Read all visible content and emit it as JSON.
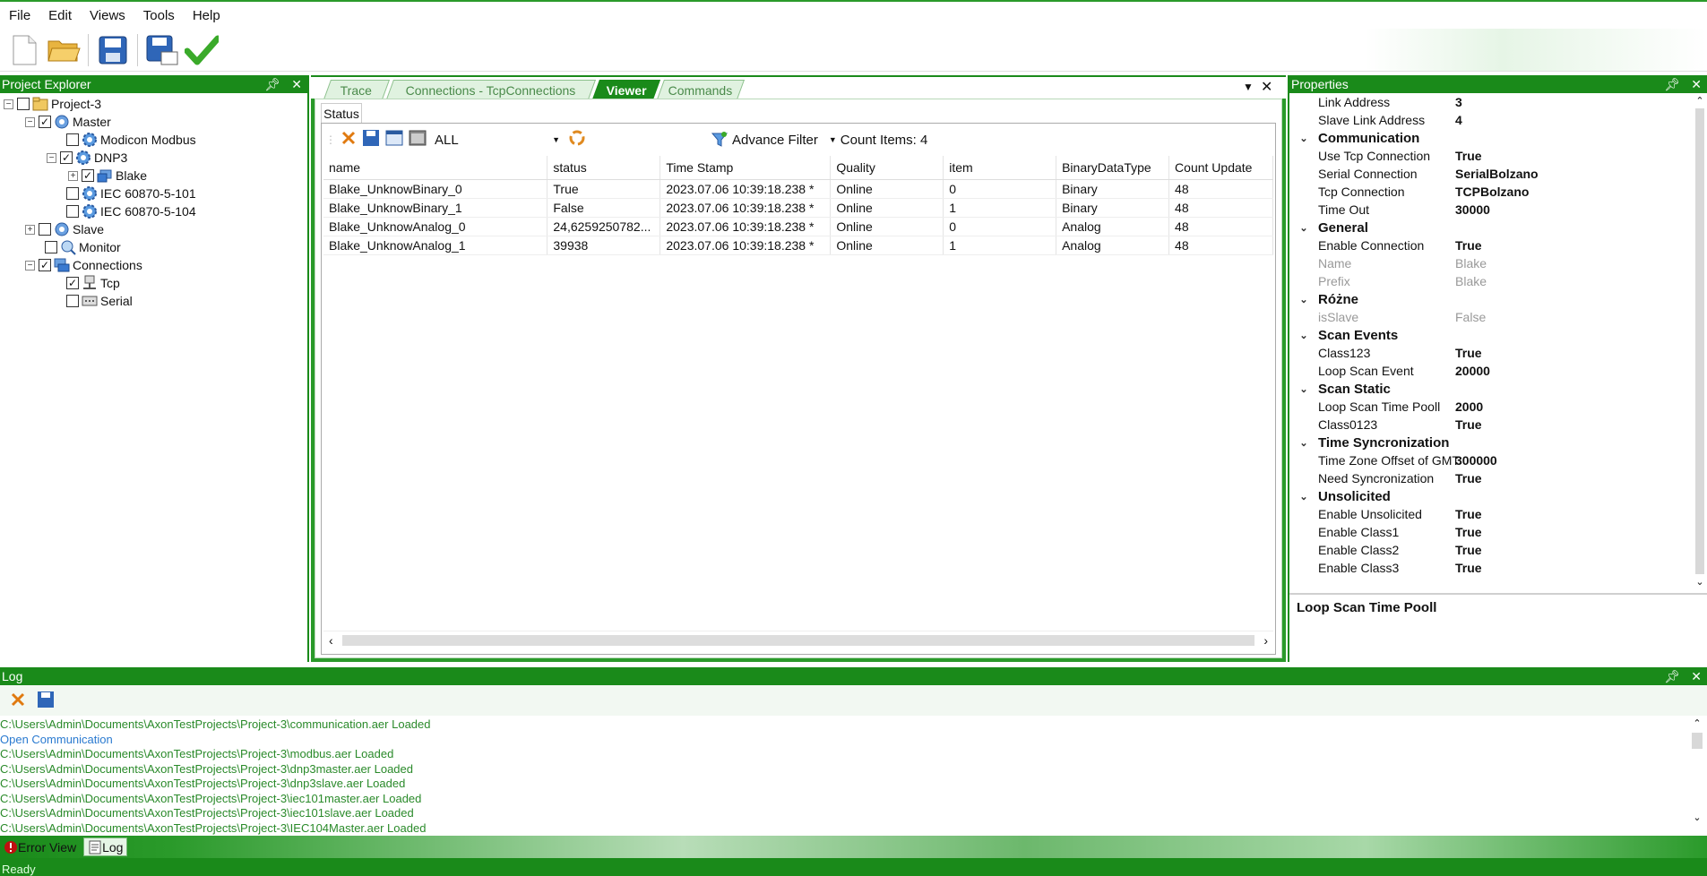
{
  "menu": [
    "File",
    "Edit",
    "Views",
    "Tools",
    "Help"
  ],
  "explorer": {
    "title": "Project Explorer",
    "items": [
      {
        "label": "Project-3"
      },
      {
        "label": "Master"
      },
      {
        "label": "Modicon Modbus"
      },
      {
        "label": "DNP3"
      },
      {
        "label": "Blake"
      },
      {
        "label": "IEC 60870-5-101"
      },
      {
        "label": "IEC 60870-5-104"
      },
      {
        "label": "Slave"
      },
      {
        "label": "Monitor"
      },
      {
        "label": "Connections"
      },
      {
        "label": "Tcp"
      },
      {
        "label": "Serial"
      }
    ]
  },
  "tabs": [
    "Trace",
    "Connections - TcpConnections",
    "Viewer",
    "Commands"
  ],
  "viewer": {
    "status_tab": "Status",
    "filter_select": "ALL",
    "advance_filter": "Advance Filter",
    "count_items": "Count Items: 4",
    "columns": [
      "name",
      "status",
      "Time Stamp",
      "Quality",
      "item",
      "BinaryDataType",
      "Count Update"
    ],
    "rows": [
      [
        "Blake_UnknowBinary_0",
        "True",
        "2023.07.06 10:39:18.238 *",
        "Online",
        "0",
        "Binary",
        "48"
      ],
      [
        "Blake_UnknowBinary_1",
        "False",
        "2023.07.06 10:39:18.238 *",
        "Online",
        "1",
        "Binary",
        "48"
      ],
      [
        "Blake_UnknowAnalog_0",
        "24,6259250782...",
        "2023.07.06 10:39:18.238 *",
        "Online",
        "0",
        "Analog",
        "48"
      ],
      [
        "Blake_UnknowAnalog_1",
        "39938",
        "2023.07.06 10:39:18.238 *",
        "Online",
        "1",
        "Analog",
        "48"
      ]
    ]
  },
  "properties": {
    "title": "Properties",
    "top_rows": [
      {
        "name": "Link Address",
        "value": "3"
      },
      {
        "name": "Slave Link Address",
        "value": "4"
      }
    ],
    "categories": [
      {
        "label": "Communication",
        "rows": [
          {
            "name": "Use Tcp Connection",
            "value": "True"
          },
          {
            "name": "Serial Connection",
            "value": "SerialBolzano"
          },
          {
            "name": "Tcp Connection",
            "value": "TCPBolzano"
          },
          {
            "name": "Time Out",
            "value": "30000"
          }
        ]
      },
      {
        "label": "General",
        "rows": [
          {
            "name": "Enable Connection",
            "value": "True"
          },
          {
            "name": "Name",
            "value": "Blake",
            "dim": true
          },
          {
            "name": "Prefix",
            "value": "Blake",
            "dim": true
          }
        ]
      },
      {
        "label": "Różne",
        "rows": [
          {
            "name": "isSlave",
            "value": "False",
            "dim": true
          }
        ]
      },
      {
        "label": "Scan Events",
        "rows": [
          {
            "name": "Class123",
            "value": "True"
          },
          {
            "name": "Loop Scan Event",
            "value": "20000"
          }
        ]
      },
      {
        "label": "Scan Static",
        "rows": [
          {
            "name": "Loop Scan Time Pooll",
            "value": "2000"
          },
          {
            "name": "Class0123",
            "value": "True"
          }
        ]
      },
      {
        "label": "Time Syncronization",
        "rows": [
          {
            "name": "Time Zone Offset of GMT",
            "value": "300000"
          },
          {
            "name": "Need Syncronization",
            "value": "True"
          }
        ]
      },
      {
        "label": "Unsolicited",
        "rows": [
          {
            "name": "Enable Unsolicited",
            "value": "True"
          },
          {
            "name": "Enable Class1",
            "value": "True"
          },
          {
            "name": "Enable Class2",
            "value": "True"
          },
          {
            "name": "Enable Class3",
            "value": "True"
          }
        ]
      }
    ],
    "description": "Loop Scan Time Pooll"
  },
  "log": {
    "title": "Log",
    "lines": [
      {
        "text": "C:\\Users\\Admin\\Documents\\AxonTestProjects\\Project-3\\communication.aer Loaded",
        "color": "#2a8a2a"
      },
      {
        "text": "Open Communication",
        "color": "#2a7ad0"
      },
      {
        "text": "C:\\Users\\Admin\\Documents\\AxonTestProjects\\Project-3\\modbus.aer Loaded",
        "color": "#2a8a2a"
      },
      {
        "text": "C:\\Users\\Admin\\Documents\\AxonTestProjects\\Project-3\\dnp3master.aer Loaded",
        "color": "#2a8a2a"
      },
      {
        "text": "C:\\Users\\Admin\\Documents\\AxonTestProjects\\Project-3\\dnp3slave.aer Loaded",
        "color": "#2a8a2a"
      },
      {
        "text": "C:\\Users\\Admin\\Documents\\AxonTestProjects\\Project-3\\iec101master.aer Loaded",
        "color": "#2a8a2a"
      },
      {
        "text": "C:\\Users\\Admin\\Documents\\AxonTestProjects\\Project-3\\iec101slave.aer Loaded",
        "color": "#2a8a2a"
      },
      {
        "text": "C:\\Users\\Admin\\Documents\\AxonTestProjects\\Project-3\\IEC104Master.aer Loaded",
        "color": "#2a8a2a"
      }
    ]
  },
  "bottom_tabs": [
    "Error View",
    "Log"
  ],
  "status": "Ready",
  "colors": {
    "accent": "#1a8a1a"
  }
}
